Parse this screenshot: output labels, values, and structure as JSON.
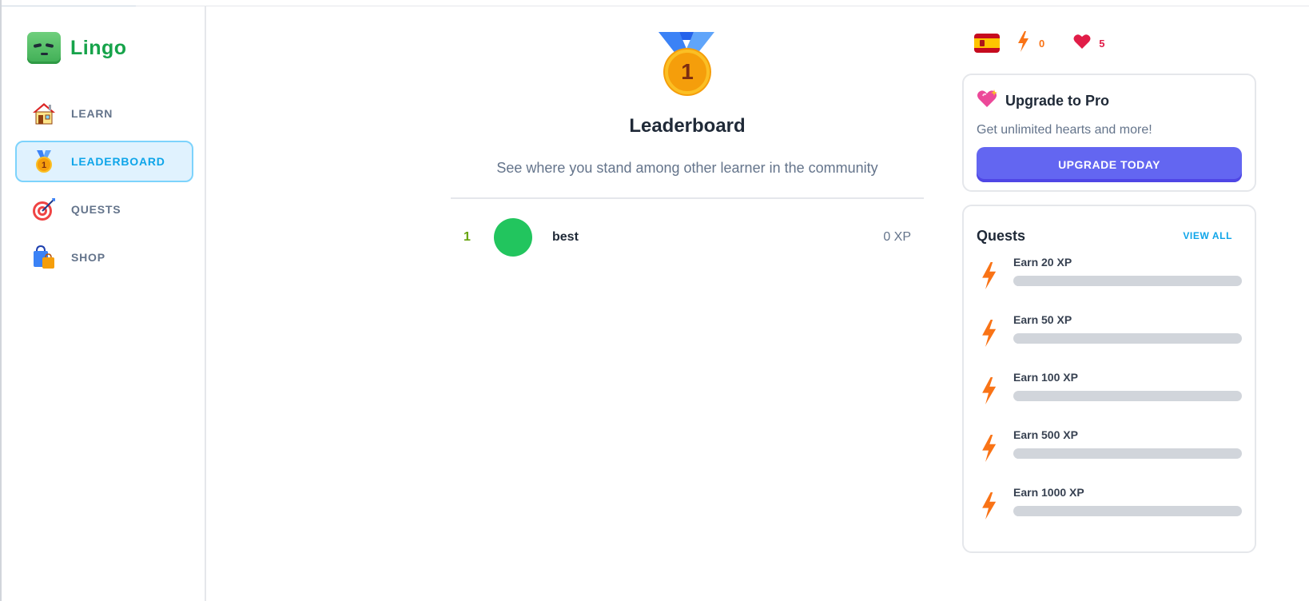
{
  "app": {
    "name": "Lingo"
  },
  "sidebar": {
    "items": [
      {
        "label": "LEARN",
        "icon": "house-icon"
      },
      {
        "label": "LEADERBOARD",
        "icon": "medal-icon",
        "active": true
      },
      {
        "label": "QUESTS",
        "icon": "target-icon"
      },
      {
        "label": "SHOP",
        "icon": "shopping-bag-icon"
      }
    ]
  },
  "leaderboard": {
    "title": "Leaderboard",
    "medal_number": "1",
    "subtitle": "See where you stand among other learner in the community",
    "rows": [
      {
        "rank": "1",
        "name": "best",
        "xp": "0 XP",
        "avatar_color": "#22c55e"
      }
    ]
  },
  "stats": {
    "language_flag": "spain-flag-icon",
    "points": "0",
    "hearts": "5"
  },
  "upgrade": {
    "title": "Upgrade to Pro",
    "subtitle": "Get unlimited hearts and more!",
    "button": "UPGRADE TODAY"
  },
  "quests": {
    "title": "Quests",
    "view_all": "VIEW ALL",
    "items": [
      {
        "label": "Earn 20 XP",
        "progress": 0
      },
      {
        "label": "Earn 50 XP",
        "progress": 0
      },
      {
        "label": "Earn 100 XP",
        "progress": 0
      },
      {
        "label": "Earn 500 XP",
        "progress": 0
      },
      {
        "label": "Earn 1000 XP",
        "progress": 0
      }
    ]
  },
  "colors": {
    "brand": "#16a34a",
    "accent": "#0ea5e9",
    "button": "#6366f1",
    "streak": "#f97316",
    "hearts": "#e11d48"
  }
}
